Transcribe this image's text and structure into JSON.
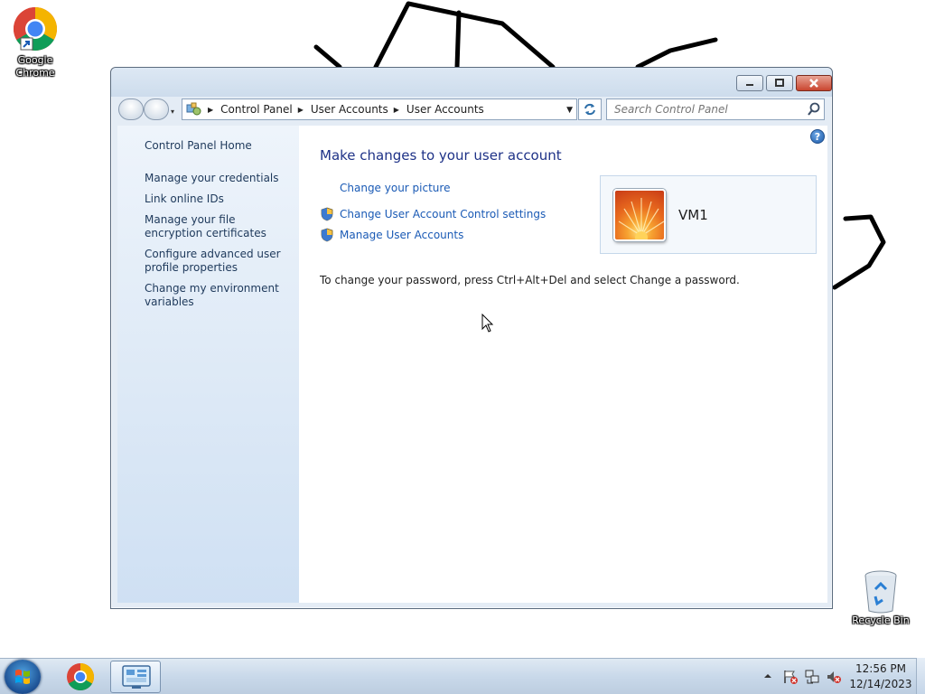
{
  "desktop": {
    "icons": [
      {
        "label": "Google Chrome",
        "icon": "chrome-icon"
      },
      {
        "label": "Recycle Bin",
        "icon": "recycle-bin-icon"
      }
    ]
  },
  "window": {
    "title": "",
    "nav": {
      "breadcrumb": [
        "Control Panel",
        "User Accounts",
        "User Accounts"
      ],
      "search_placeholder": "Search Control Panel"
    },
    "sidebar": {
      "items": [
        {
          "label": "Control Panel Home"
        },
        {
          "label": "Manage your credentials"
        },
        {
          "label": "Link online IDs"
        },
        {
          "label": "Manage your file encryption certificates"
        },
        {
          "label": "Configure advanced user profile properties"
        },
        {
          "label": "Change my environment variables"
        }
      ]
    },
    "main": {
      "title": "Make changes to your user account",
      "tasks": [
        {
          "label": "Change your picture",
          "icon": ""
        },
        {
          "label": "Change User Account Control settings",
          "icon": "uac-shield-icon"
        },
        {
          "label": "Manage User Accounts",
          "icon": "uac-shield-icon"
        }
      ],
      "password_note": "To change your password, press Ctrl+Alt+Del and select Change a password.",
      "user": {
        "name": "VM1",
        "picture": "flower-picture"
      }
    }
  },
  "taskbar": {
    "items": [
      {
        "icon": "start-orb"
      },
      {
        "icon": "chrome-icon"
      },
      {
        "icon": "control-panel-icon",
        "active": true
      }
    ],
    "clock": {
      "time": "12:56 PM",
      "date": "12/14/2023"
    }
  }
}
